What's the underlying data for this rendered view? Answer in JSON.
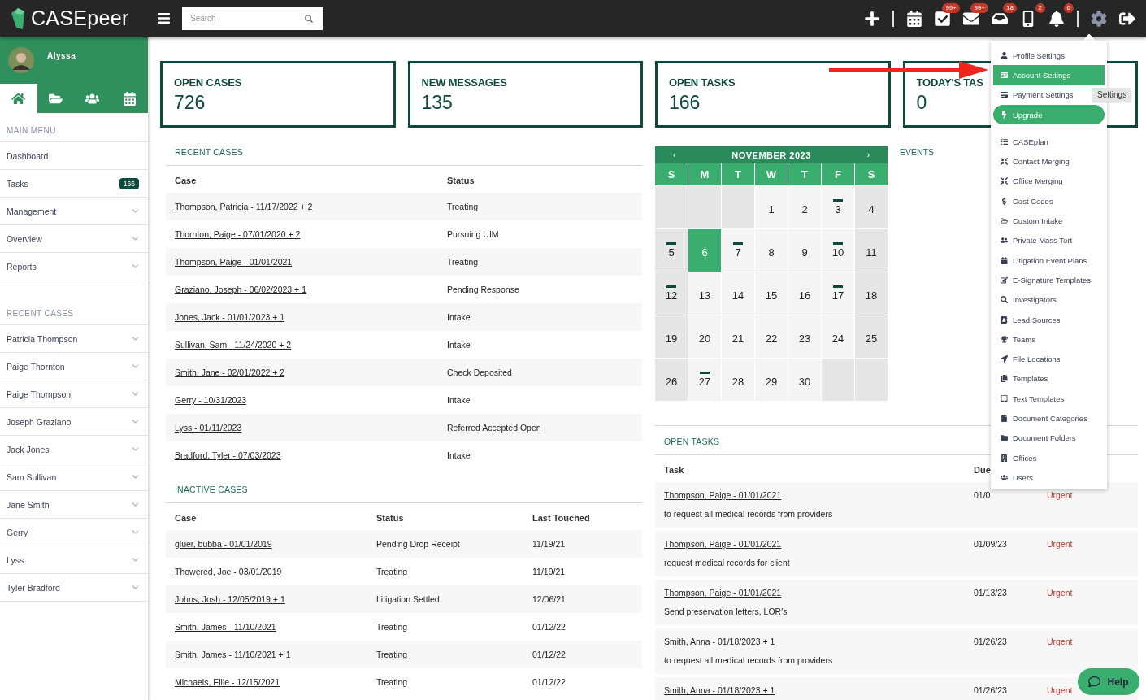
{
  "topbar": {
    "logo": "CASEpeer",
    "search": {
      "placeholder": "Search"
    },
    "actions": [
      {
        "kind": "add"
      },
      {
        "kind": "calendar"
      },
      {
        "kind": "tasks",
        "badge": "99+"
      },
      {
        "kind": "messages",
        "badge": "99+"
      },
      {
        "kind": "inbox",
        "badge": "18"
      },
      {
        "kind": "texts",
        "badge": "2"
      },
      {
        "kind": "notifications",
        "badge": "6"
      },
      {
        "kind": "settings"
      },
      {
        "kind": "logout"
      }
    ]
  },
  "sidebar": {
    "user": "Alyssa",
    "tabs": [
      {
        "kind": "home",
        "selected": true
      },
      {
        "kind": "folders",
        "selected": false
      },
      {
        "kind": "contacts",
        "selected": false
      },
      {
        "kind": "calendar",
        "selected": false
      }
    ],
    "main_menu_label": "MAIN MENU",
    "menu": [
      {
        "label": "Dashboard",
        "expandable": false
      },
      {
        "label": "Tasks",
        "count": "166",
        "expandable": false
      },
      {
        "label": "Management",
        "expandable": true
      },
      {
        "label": "Overview",
        "expandable": true
      },
      {
        "label": "Reports",
        "expandable": true
      }
    ],
    "recent_label": "RECENT CASES",
    "recent": [
      {
        "label": "Patricia Thompson",
        "expandable": true
      },
      {
        "label": "Paige Thornton",
        "expandable": true
      },
      {
        "label": "Paige Thompson",
        "expandable": true
      },
      {
        "label": "Joseph Graziano",
        "expandable": true
      },
      {
        "label": "Jack Jones",
        "expandable": true
      },
      {
        "label": "Sam Sullivan",
        "expandable": true
      },
      {
        "label": "Jane Smith",
        "expandable": true
      },
      {
        "label": "Gerry",
        "expandable": true
      },
      {
        "label": "Lyss",
        "expandable": true
      },
      {
        "label": "Tyler Bradford",
        "expandable": true
      }
    ]
  },
  "stats": [
    {
      "title": "OPEN CASES",
      "value": "726"
    },
    {
      "title": "NEW MESSAGES",
      "value": "135"
    },
    {
      "title": "OPEN TASKS",
      "value": "166"
    },
    {
      "title": "TODAY'S TAS",
      "value": "0"
    }
  ],
  "recent_cases": {
    "title": "RECENT CASES",
    "columns": [
      "Case",
      "Status"
    ],
    "rows": [
      {
        "case": "Thompson, Patricia - 11/17/2022 + 2",
        "status": "Treating"
      },
      {
        "case": "Thornton, Paige - 07/01/2020 + 2",
        "status": "Pursuing UIM"
      },
      {
        "case": "Thompson, Paige - 01/01/2021",
        "status": "Treating"
      },
      {
        "case": "Graziano, Joseph - 06/02/2023 + 1",
        "status": "Pending Response"
      },
      {
        "case": "Jones, Jack - 01/01/2023 + 1",
        "status": "Intake"
      },
      {
        "case": "Sullivan, Sam - 11/24/2020 + 2",
        "status": "Intake"
      },
      {
        "case": "Smith, Jane - 02/01/2022 + 2",
        "status": "Check Deposited"
      },
      {
        "case": "Gerry - 10/31/2023",
        "status": "Intake"
      },
      {
        "case": "Lyss - 01/11/2023",
        "status": "Referred Accepted Open"
      },
      {
        "case": "Bradford, Tyler - 07/03/2023",
        "status": "Intake"
      }
    ]
  },
  "inactive_cases": {
    "title": "INACTIVE CASES",
    "columns": [
      "Case",
      "Status",
      "Last Touched"
    ],
    "rows": [
      {
        "case": "gluer, bubba - 01/01/2019",
        "status": "Pending Drop Receipt",
        "last_touched": "11/19/21"
      },
      {
        "case": "Thowered, Joe - 03/01/2019",
        "status": "Treating",
        "last_touched": "11/19/21"
      },
      {
        "case": "Johns, Josh - 12/05/2019 + 1",
        "status": "Litigation Settled",
        "last_touched": "12/06/21"
      },
      {
        "case": "Smith, James - 11/10/2021",
        "status": "Treating",
        "last_touched": "01/12/22"
      },
      {
        "case": "Smith, James - 11/10/2021 + 1",
        "status": "Treating",
        "last_touched": "01/12/22"
      },
      {
        "case": "Michaels, Ellie - 12/15/2021",
        "status": "Treating",
        "last_touched": "01/12/22"
      }
    ]
  },
  "calendar": {
    "month": "NOVEMBER 2023",
    "prev": "‹",
    "next": "›",
    "weekdays": [
      "S",
      "M",
      "T",
      "W",
      "T",
      "F",
      "S"
    ],
    "weeks": [
      [
        {
          "outside": true
        },
        {
          "outside": true
        },
        {
          "outside": true
        },
        {
          "day": "1",
          "event": false,
          "selected": false
        },
        {
          "day": "2",
          "event": false,
          "selected": false
        },
        {
          "day": "3",
          "event": true,
          "selected": false
        },
        {
          "day": "4",
          "event": false,
          "selected": false
        }
      ],
      [
        {
          "day": "5",
          "event": true,
          "selected": false
        },
        {
          "day": "6",
          "event": false,
          "selected": true
        },
        {
          "day": "7",
          "event": true,
          "selected": false
        },
        {
          "day": "8",
          "event": false,
          "selected": false
        },
        {
          "day": "9",
          "event": false,
          "selected": false
        },
        {
          "day": "10",
          "event": true,
          "selected": false
        },
        {
          "day": "11",
          "event": false,
          "selected": false
        }
      ],
      [
        {
          "day": "12",
          "event": true,
          "selected": false
        },
        {
          "day": "13",
          "event": false,
          "selected": false
        },
        {
          "day": "14",
          "event": false,
          "selected": false
        },
        {
          "day": "15",
          "event": false,
          "selected": false
        },
        {
          "day": "16",
          "event": false,
          "selected": false
        },
        {
          "day": "17",
          "event": true,
          "selected": false
        },
        {
          "day": "18",
          "event": false,
          "selected": false
        }
      ],
      [
        {
          "day": "19",
          "event": false,
          "selected": false
        },
        {
          "day": "20",
          "event": false,
          "selected": false
        },
        {
          "day": "21",
          "event": false,
          "selected": false
        },
        {
          "day": "22",
          "event": false,
          "selected": false
        },
        {
          "day": "23",
          "event": false,
          "selected": false
        },
        {
          "day": "24",
          "event": false,
          "selected": false
        },
        {
          "day": "25",
          "event": false,
          "selected": false
        }
      ],
      [
        {
          "day": "26",
          "event": false,
          "selected": false
        },
        {
          "day": "27",
          "event": true,
          "selected": false
        },
        {
          "day": "28",
          "event": false,
          "selected": false
        },
        {
          "day": "29",
          "event": false,
          "selected": false
        },
        {
          "day": "30",
          "event": false,
          "selected": false
        },
        {
          "outside": true
        },
        {
          "outside": true
        }
      ]
    ]
  },
  "events": {
    "title": "EVENTS"
  },
  "open_tasks": {
    "title": "OPEN TASKS",
    "columns": [
      "Task",
      "Due"
    ],
    "rows": [
      {
        "case": "Thompson, Paige - 01/01/2021",
        "task": "to request all medical records from providers",
        "due": "01/0",
        "priority": "Urgent"
      },
      {
        "case": "Thompson, Paige - 01/01/2021",
        "task": "request medical records for client",
        "due": "01/09/23",
        "priority": "Urgent"
      },
      {
        "case": "Thompson, Paige - 01/01/2021",
        "task": "Send preservation letters, LOR's",
        "due": "01/13/23",
        "priority": "Urgent"
      },
      {
        "case": "Smith, Anna - 01/18/2023 + 1",
        "task": "to request all medical records from providers",
        "due": "01/26/23",
        "priority": "Urgent"
      },
      {
        "case": "Smith, Anna - 01/18/2023 + 1",
        "due": "01/26/23",
        "priority": "Urgent"
      }
    ]
  },
  "settings_menu": {
    "tooltip": "Settings",
    "items": [
      {
        "label": "Profile Settings",
        "kind": "link",
        "selected": false
      },
      {
        "label": "Account Settings",
        "kind": "link",
        "selected": true
      },
      {
        "label": "Payment Settings",
        "kind": "link",
        "selected": false
      },
      {
        "label": "Upgrade",
        "kind": "button"
      },
      {
        "kind": "divider"
      },
      {
        "label": "CASEplan",
        "kind": "link",
        "selected": false
      },
      {
        "label": "Contact Merging",
        "kind": "link",
        "selected": false
      },
      {
        "label": "Office Merging",
        "kind": "link",
        "selected": false
      },
      {
        "label": "Cost Codes",
        "kind": "link",
        "selected": false
      },
      {
        "label": "Custom Intake",
        "kind": "link",
        "selected": false
      },
      {
        "label": "Private Mass Tort",
        "kind": "link",
        "selected": false
      },
      {
        "label": "Litigation Event Plans",
        "kind": "link",
        "selected": false
      },
      {
        "label": "E-Signature Templates",
        "kind": "link",
        "selected": false
      },
      {
        "label": "Investigators",
        "kind": "link",
        "selected": false
      },
      {
        "label": "Lead Sources",
        "kind": "link",
        "selected": false
      },
      {
        "label": "Teams",
        "kind": "link",
        "selected": false
      },
      {
        "label": "File Locations",
        "kind": "link",
        "selected": false
      },
      {
        "label": "Templates",
        "kind": "link",
        "selected": false
      },
      {
        "label": "Text Templates",
        "kind": "link",
        "selected": false
      },
      {
        "label": "Document Categories",
        "kind": "link",
        "selected": false
      },
      {
        "label": "Document Folders",
        "kind": "link",
        "selected": false
      },
      {
        "label": "Offices",
        "kind": "link",
        "selected": false
      },
      {
        "label": "Users",
        "kind": "link",
        "selected": false
      }
    ]
  },
  "help": {
    "label": "Help"
  }
}
